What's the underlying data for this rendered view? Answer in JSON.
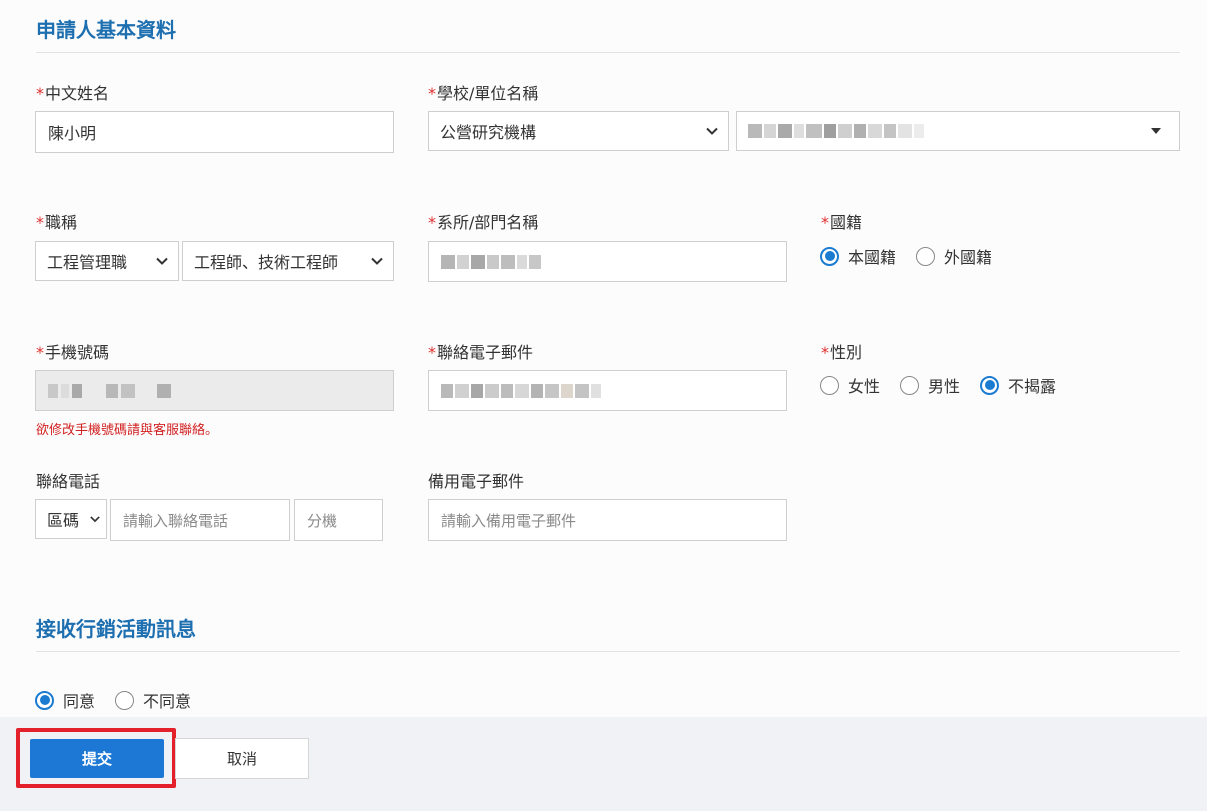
{
  "section_basic": {
    "title": "申請人基本資料"
  },
  "fields": {
    "chinese_name": {
      "label": "中文姓名",
      "value": "陳小明"
    },
    "school": {
      "label": "學校/單位名稱",
      "type_value": "公營研究機構"
    },
    "job_title": {
      "label": "職稱",
      "category_value": "工程管理職",
      "title_value": "工程師、技術工程師"
    },
    "department": {
      "label": "系所/部門名稱"
    },
    "nationality": {
      "label": "國籍",
      "options": [
        "本國籍",
        "外國籍"
      ]
    },
    "mobile": {
      "label": "手機號碼",
      "hint": "欲修改手機號碼請與客服聯絡。"
    },
    "email": {
      "label": "聯絡電子郵件"
    },
    "gender": {
      "label": "性別",
      "options": [
        "女性",
        "男性",
        "不揭露"
      ]
    },
    "phone": {
      "label": "聯絡電話",
      "area_value": "區碼",
      "number_placeholder": "請輸入聯絡電話",
      "ext_placeholder": "分機"
    },
    "backup_email": {
      "label": "備用電子郵件",
      "placeholder": "請輸入備用電子郵件"
    }
  },
  "section_marketing": {
    "title": "接收行銷活動訊息",
    "options": [
      "同意",
      "不同意"
    ]
  },
  "footer": {
    "submit_label": "提交",
    "cancel_label": "取消"
  },
  "required_mark": "*",
  "colors": {
    "accent": "#1c78d4",
    "title": "#1d6fb0",
    "required": "#e0302d",
    "highlight": "#e4202a"
  }
}
